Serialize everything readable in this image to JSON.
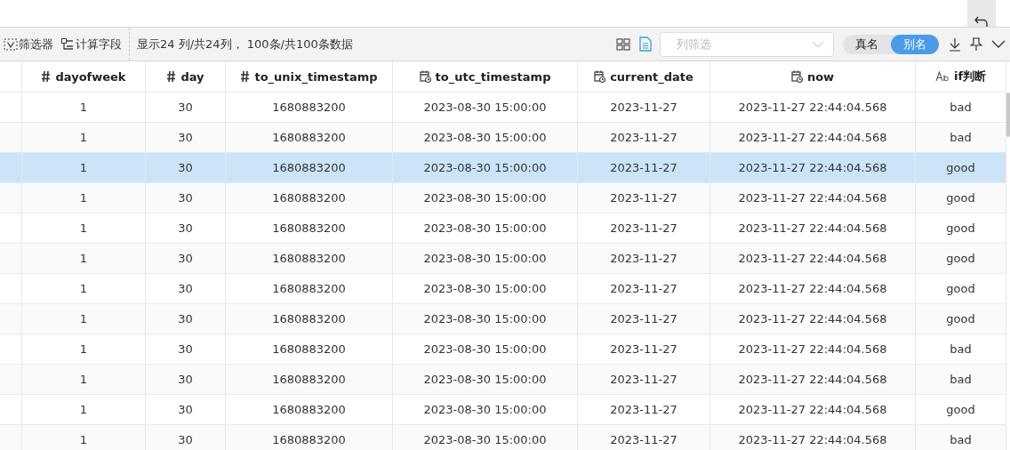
{
  "toolbar": {
    "filter_button": "筛选器",
    "calc_button": "计算字段",
    "summary": "显示24 列/共24列， 100条/共100条数据",
    "column_filter": {
      "placeholder": "列筛选"
    },
    "name_toggle": [
      {
        "label": "真名",
        "selected": false
      },
      {
        "label": "别名",
        "selected": true
      }
    ]
  },
  "table": {
    "columns": [
      {
        "label": "dayofweek",
        "kind": "number"
      },
      {
        "label": "day",
        "kind": "number"
      },
      {
        "label": "to_unix_timestamp",
        "kind": "number"
      },
      {
        "label": "to_utc_timestamp",
        "kind": "date"
      },
      {
        "label": "current_date",
        "kind": "date"
      },
      {
        "label": "now",
        "kind": "date"
      },
      {
        "label": "if判断",
        "kind": "text"
      }
    ],
    "rows": [
      {
        "selected": false,
        "cells": [
          "1",
          "30",
          "1680883200",
          "2023-08-30 15:00:00",
          "2023-11-27",
          "2023-11-27 22:44:04.568",
          "bad"
        ]
      },
      {
        "selected": false,
        "cells": [
          "1",
          "30",
          "1680883200",
          "2023-08-30 15:00:00",
          "2023-11-27",
          "2023-11-27 22:44:04.568",
          "bad"
        ]
      },
      {
        "selected": true,
        "cells": [
          "1",
          "30",
          "1680883200",
          "2023-08-30 15:00:00",
          "2023-11-27",
          "2023-11-27 22:44:04.568",
          "good"
        ]
      },
      {
        "selected": false,
        "cells": [
          "1",
          "30",
          "1680883200",
          "2023-08-30 15:00:00",
          "2023-11-27",
          "2023-11-27 22:44:04.568",
          "good"
        ]
      },
      {
        "selected": false,
        "cells": [
          "1",
          "30",
          "1680883200",
          "2023-08-30 15:00:00",
          "2023-11-27",
          "2023-11-27 22:44:04.568",
          "good"
        ]
      },
      {
        "selected": false,
        "cells": [
          "1",
          "30",
          "1680883200",
          "2023-08-30 15:00:00",
          "2023-11-27",
          "2023-11-27 22:44:04.568",
          "good"
        ]
      },
      {
        "selected": false,
        "cells": [
          "1",
          "30",
          "1680883200",
          "2023-08-30 15:00:00",
          "2023-11-27",
          "2023-11-27 22:44:04.568",
          "good"
        ]
      },
      {
        "selected": false,
        "cells": [
          "1",
          "30",
          "1680883200",
          "2023-08-30 15:00:00",
          "2023-11-27",
          "2023-11-27 22:44:04.568",
          "good"
        ]
      },
      {
        "selected": false,
        "cells": [
          "1",
          "30",
          "1680883200",
          "2023-08-30 15:00:00",
          "2023-11-27",
          "2023-11-27 22:44:04.568",
          "bad"
        ]
      },
      {
        "selected": false,
        "cells": [
          "1",
          "30",
          "1680883200",
          "2023-08-30 15:00:00",
          "2023-11-27",
          "2023-11-27 22:44:04.568",
          "bad"
        ]
      },
      {
        "selected": false,
        "cells": [
          "1",
          "30",
          "1680883200",
          "2023-08-30 15:00:00",
          "2023-11-27",
          "2023-11-27 22:44:04.568",
          "good"
        ]
      },
      {
        "selected": false,
        "cells": [
          "1",
          "30",
          "1680883200",
          "2023-08-30 15:00:00",
          "2023-11-27",
          "2023-11-27 22:44:04.568",
          "bad"
        ]
      }
    ]
  }
}
